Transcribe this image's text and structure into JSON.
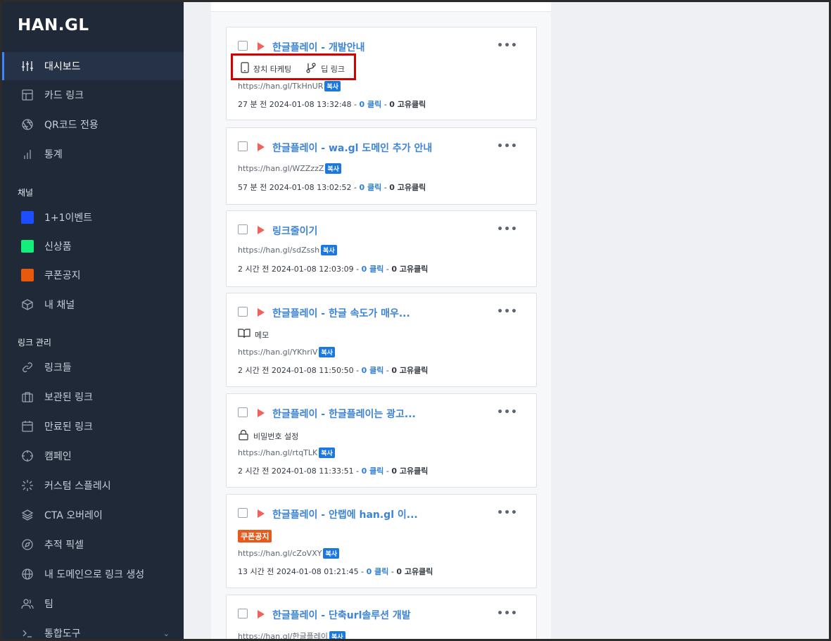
{
  "app": {
    "logo": "HAN.GL"
  },
  "sidebar": {
    "items": [
      {
        "label": "대시보드",
        "icon": "sliders-icon",
        "active": true
      },
      {
        "label": "카드 링크",
        "icon": "layout-icon"
      },
      {
        "label": "QR코드 전용",
        "icon": "aperture-icon"
      },
      {
        "label": "통계",
        "icon": "bar-chart-icon"
      }
    ],
    "channels_label": "채널",
    "channels": [
      {
        "label": "1+1이벤트",
        "color": "#1e4dff"
      },
      {
        "label": "신상품",
        "color": "#13f07a"
      },
      {
        "label": "쿠폰공지",
        "color": "#e8590c"
      },
      {
        "label": "내 채널",
        "icon": "box-icon"
      }
    ],
    "links_label": "링크 관리",
    "links": [
      {
        "label": "링크들",
        "icon": "link-icon"
      },
      {
        "label": "보관된 링크",
        "icon": "briefcase-icon"
      },
      {
        "label": "만료된 링크",
        "icon": "calendar-icon"
      },
      {
        "label": "캠페인",
        "icon": "crosshair-icon"
      },
      {
        "label": "커스텀 스플레시",
        "icon": "loader-icon"
      },
      {
        "label": "CTA 오버레이",
        "icon": "layers-icon"
      },
      {
        "label": "추적 픽셀",
        "icon": "compass-icon"
      },
      {
        "label": "내 도메인으로 링크 생성",
        "icon": "globe-icon"
      },
      {
        "label": "팀",
        "icon": "users-icon"
      },
      {
        "label": "통합도구",
        "icon": "terminal-icon"
      }
    ]
  },
  "common": {
    "copy": "복사",
    "clicks_suffix": "클릭",
    "unique_suffix": "고유클릭",
    "separator": " - "
  },
  "cards": [
    {
      "title": "한글플레이 - 개발안내",
      "features": [
        {
          "icon": "smartphone-icon",
          "label": "장치 타케팅"
        },
        {
          "icon": "git-branch-icon",
          "label": "딥 링크"
        }
      ],
      "url": "https://han.gl/TkHnUR",
      "time": "27 분 전 2024-01-08 13:32:48",
      "clicks": "0",
      "unique": "0"
    },
    {
      "title": "한글플레이 - wa.gl 도메인 추가 안내",
      "url": "https://han.gl/WZZzzZ",
      "time": "57 분 전 2024-01-08 13:02:52",
      "clicks": "0",
      "unique": "0"
    },
    {
      "title": "링크줄이기",
      "url": "https://han.gl/sdZssh",
      "time": "2 시간 전 2024-01-08 12:03:09",
      "clicks": "0",
      "unique": "0"
    },
    {
      "title": "한글플레이 - 한글 속도가 매우...",
      "features": [
        {
          "icon": "book-open-icon",
          "label": "메모"
        }
      ],
      "url": "https://han.gl/YKhriV",
      "time": "2 시간 전 2024-01-08 11:50:50",
      "clicks": "0",
      "unique": "0"
    },
    {
      "title": "한글플레이 - 한글플레이는 광고...",
      "features": [
        {
          "icon": "lock-icon",
          "label": "비밀번호 설정"
        }
      ],
      "url": "https://han.gl/rtqTLK",
      "time": "2 시간 전 2024-01-08 11:33:51",
      "clicks": "0",
      "unique": "0"
    },
    {
      "title": "한글플레이 - 안랩에 han.gl 이...",
      "tag": "쿠폰공지",
      "url": "https://han.gl/cZoVXY",
      "time": "13 시간 전 2024-01-08 01:21:45",
      "clicks": "0",
      "unique": "0"
    },
    {
      "title": "한글플레이 - 단축url솔루션 개발",
      "url": "https://han.gl/한글플레이"
    }
  ]
}
